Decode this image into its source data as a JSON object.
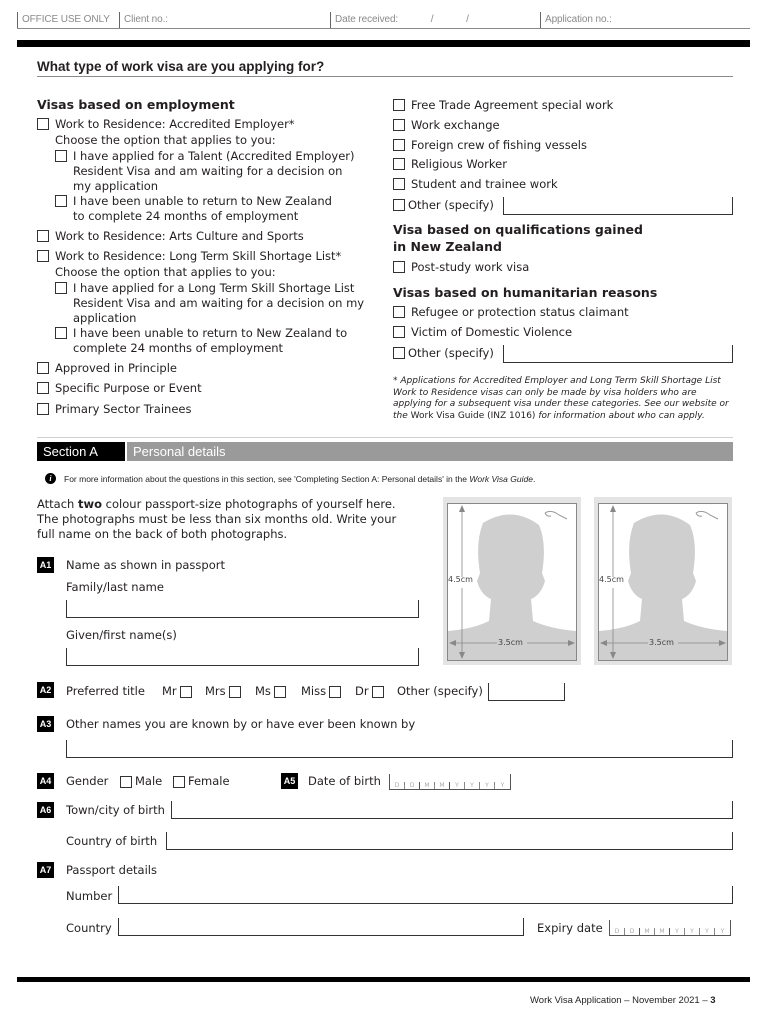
{
  "office_bar": {
    "office_use_only": "OFFICE USE ONLY",
    "client_no_label": "Client no.:",
    "date_received_label": "Date received:",
    "date_sep1": "/",
    "date_sep2": "/",
    "application_no_label": "Application no.:"
  },
  "visa_type": {
    "title": "What type of work visa are you applying for?",
    "employment": {
      "heading": "Visas based on employment",
      "accredited": {
        "label": "Work to Residence: Accredited Employer*",
        "choose": "Choose the option that applies to you:",
        "opt1": "I have applied for a Talent (Accredited Employer) Resident Visa and am waiting for a decision on my application",
        "opt1_l1": "I have applied for a Talent (Accredited Employer)",
        "opt1_l2": "Resident Visa and am waiting for a decision on",
        "opt1_l3": "my application",
        "opt2_l1": "I have been unable to return to New Zealand",
        "opt2_l2": "to complete 24 months of employment"
      },
      "arts": "Work to Residence: Arts Culture and Sports",
      "ltssl": {
        "label": "Work to Residence: Long Term Skill Shortage List*",
        "choose": "Choose the option that applies to you:",
        "opt1_l1": "I have applied for a Long Term Skill Shortage List",
        "opt1_l2": "Resident Visa and am waiting for a decision on my",
        "opt1_l3": "application",
        "opt2_l1": "I have been unable to return to New Zealand to",
        "opt2_l2": "complete 24 months of employment"
      },
      "approved": "Approved in Principle",
      "specific": "Specific Purpose or Event",
      "primary": "Primary Sector Trainees",
      "fta": "Free Trade Agreement special work",
      "exchange": "Work exchange",
      "fishing": "Foreign crew of fishing vessels",
      "religious": "Religious Worker",
      "student": "Student and trainee work",
      "other": "Other (specify)"
    },
    "qualifications": {
      "heading_l1": "Visa based on qualifications gained",
      "heading_l2": "in New Zealand",
      "post_study": "Post-study work visa"
    },
    "humanitarian": {
      "heading": "Visas based on humanitarian reasons",
      "refugee": "Refugee or protection status claimant",
      "domestic": "Victim of Domestic Violence",
      "other": "Other (specify)"
    },
    "note_italic_1": "* Applications for Accredited Employer and Long Term Skill Shortage List Work to Residence visas can only be made by visa holders who are applying for a subsequent visa under these categories. See our website or the ",
    "note_upright": "Work Visa Guide (INZ 1016)",
    "note_italic_2": " for information about who can apply."
  },
  "section_a": {
    "tag": "Section A",
    "title": "Personal details",
    "info_pre": "For more information about the questions in this section, see 'Completing Section A: Personal details' in the ",
    "info_guide": "Work Visa Guide",
    "info_post": ".",
    "attach_pre": "Attach ",
    "attach_bold": "two",
    "attach_post": " colour passport-size photographs of yourself here. The photographs must be less than six months old. Write your full name on the back of both photographs.",
    "photo_height_label": "4.5cm",
    "photo_width_label": "3.5cm",
    "a1": {
      "badge": "A1",
      "label": "Name as shown in passport",
      "family": "Family/last name",
      "given": "Given/first name(s)"
    },
    "a2": {
      "badge": "A2",
      "label": "Preferred title",
      "mr": "Mr",
      "mrs": "Mrs",
      "ms": "Ms",
      "miss": "Miss",
      "dr": "Dr",
      "other": "Other (specify)"
    },
    "a3": {
      "badge": "A3",
      "label": "Other names you are known by or have ever been known by"
    },
    "a4": {
      "badge": "A4",
      "label": "Gender",
      "male": "Male",
      "female": "Female"
    },
    "a5": {
      "badge": "A5",
      "label": "Date of birth"
    },
    "a6": {
      "badge": "A6",
      "town": "Town/city of birth",
      "country": "Country of birth"
    },
    "a7": {
      "badge": "A7",
      "label": "Passport details",
      "number": "Number",
      "country": "Country",
      "expiry": "Expiry date"
    },
    "date_placeholders": [
      "D",
      "D",
      "M",
      "M",
      "Y",
      "Y",
      "Y",
      "Y"
    ]
  },
  "footer": {
    "text": "Work Visa Application – November 2021 – ",
    "page": "3"
  }
}
